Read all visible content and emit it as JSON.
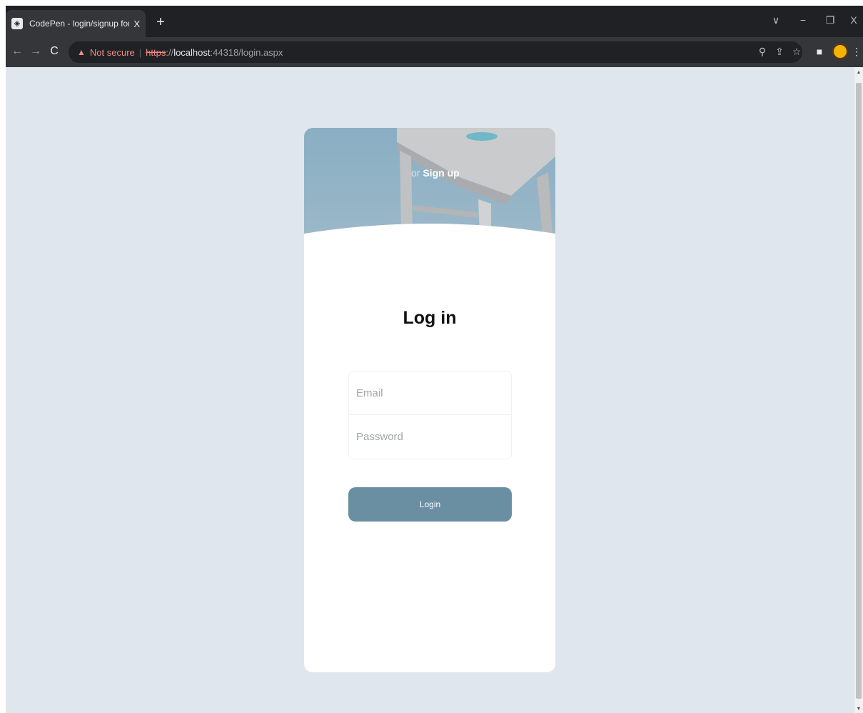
{
  "browser": {
    "tab_title": "CodePen - login/signup form ani",
    "tab_favicon_icon": "codepen-icon",
    "new_tab_symbol": "+",
    "close_symbol": "X",
    "not_secure_label": "Not secure",
    "url_scheme": "https",
    "url_separator": "://",
    "url_host": "localhost",
    "url_rest": ":44318/login.aspx"
  },
  "card": {
    "signup_prefix": "or",
    "signup_label": "Sign up",
    "title": "Log in",
    "email_placeholder": "Email",
    "password_placeholder": "Password",
    "login_label": "Login"
  },
  "colors": {
    "page_background": "#e0e6ee",
    "hero_background": "#8aaec2",
    "button_background": "#6a8fa2",
    "not_secure": "#f28b82"
  }
}
